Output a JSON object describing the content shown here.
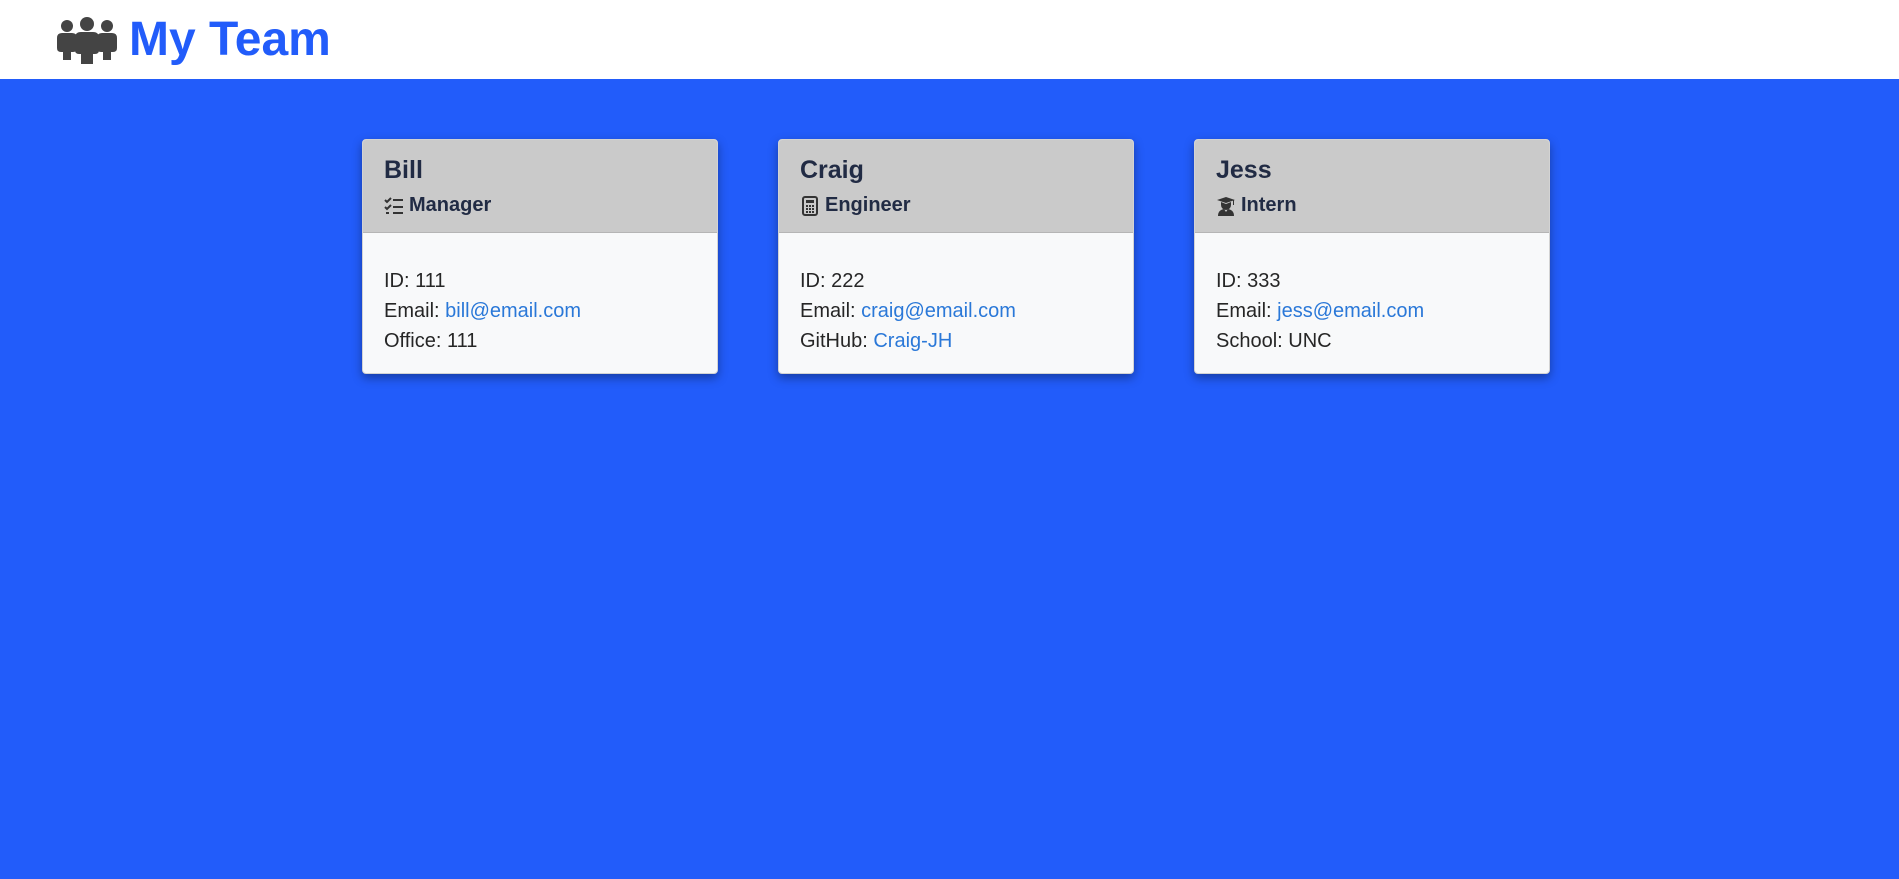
{
  "header": {
    "title": "My Team",
    "logo_icon": "team-people-icon"
  },
  "colors": {
    "background": "#225cfa",
    "accent": "#225cfa",
    "card_header": "#cacaca",
    "link": "#2a78d8"
  },
  "cards": [
    {
      "name": "Bill",
      "role": "Manager",
      "role_icon": "task-list-icon",
      "id_label": "ID: 111",
      "email_label": "Email: ",
      "email": "bill@email.com",
      "extra_label": "Office: 111",
      "extra_link": ""
    },
    {
      "name": "Craig",
      "role": "Engineer",
      "role_icon": "calculator-icon",
      "id_label": "ID: 222",
      "email_label": "Email: ",
      "email": "craig@email.com",
      "extra_label": "GitHub: ",
      "extra_link": "Craig-JH"
    },
    {
      "name": "Jess",
      "role": "Intern",
      "role_icon": "graduate-icon",
      "id_label": "ID: 333",
      "email_label": "Email: ",
      "email": "jess@email.com",
      "extra_label": "School: UNC",
      "extra_link": ""
    }
  ]
}
